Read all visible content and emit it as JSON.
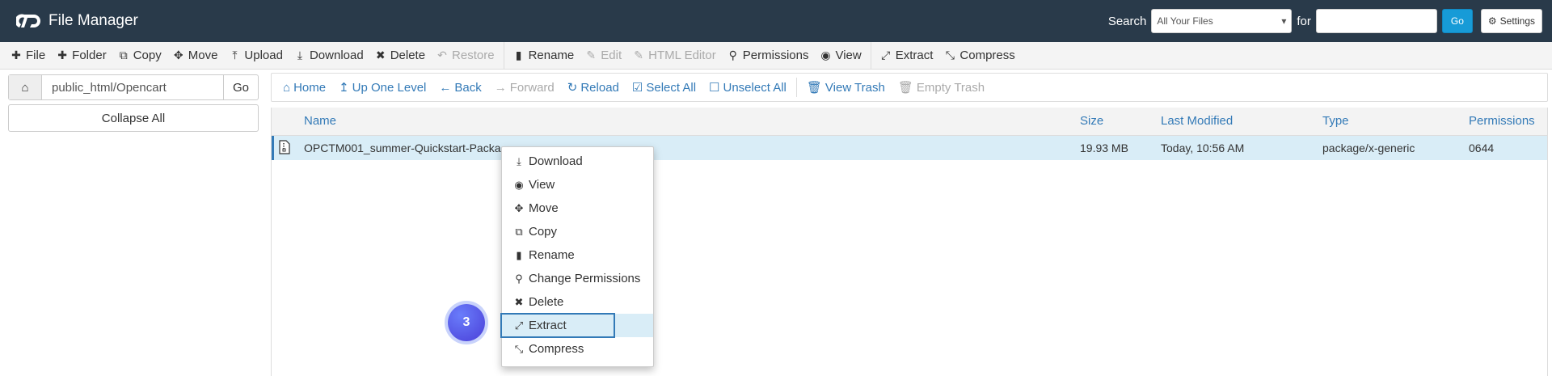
{
  "header": {
    "title": "File Manager",
    "search_label": "Search",
    "search_select_value": "All Your Files",
    "for_label": "for",
    "search_value": "",
    "go_label": "Go",
    "settings_label": "Settings"
  },
  "toolbar": {
    "items": [
      {
        "label": "File",
        "icon": "plus-icon"
      },
      {
        "label": "Folder",
        "icon": "plus-icon"
      },
      {
        "label": "Copy",
        "icon": "copy-icon"
      },
      {
        "label": "Move",
        "icon": "move-icon"
      },
      {
        "label": "Upload",
        "icon": "upload-icon"
      },
      {
        "label": "Download",
        "icon": "download-icon"
      },
      {
        "label": "Delete",
        "icon": "close-icon"
      },
      {
        "label": "Restore",
        "icon": "restore-icon"
      },
      {
        "label": "Rename",
        "icon": "file-icon"
      },
      {
        "label": "Edit",
        "icon": "pencil-icon"
      },
      {
        "label": "HTML Editor",
        "icon": "html-editor-icon"
      },
      {
        "label": "Permissions",
        "icon": "key-icon"
      },
      {
        "label": "View",
        "icon": "eye-icon"
      },
      {
        "label": "Extract",
        "icon": "expand-icon"
      },
      {
        "label": "Compress",
        "icon": "compress-icon"
      }
    ]
  },
  "left_pane": {
    "path_value": "public_html/Opencart",
    "go_label": "Go",
    "collapse_label": "Collapse All"
  },
  "navbar": {
    "items": [
      {
        "label": "Home",
        "icon": "home-icon"
      },
      {
        "label": "Up One Level",
        "icon": "level-up-icon"
      },
      {
        "label": "Back",
        "icon": "arrow-left-icon"
      },
      {
        "label": "Forward",
        "icon": "arrow-right-icon"
      },
      {
        "label": "Reload",
        "icon": "refresh-icon"
      },
      {
        "label": "Select All",
        "icon": "checkbox-checked-icon"
      },
      {
        "label": "Unselect All",
        "icon": "checkbox-empty-icon"
      },
      {
        "label": "View Trash",
        "icon": "trash-icon"
      },
      {
        "label": "Empty Trash",
        "icon": "trash-icon"
      }
    ]
  },
  "file_table": {
    "columns": [
      "Name",
      "Size",
      "Last Modified",
      "Type",
      "Permissions"
    ],
    "rows": [
      {
        "name": "OPCTM001_summer-Quickstart-Packa",
        "size": "19.93 MB",
        "modified": "Today, 10:56 AM",
        "type": "package/x-generic",
        "permissions": "0644"
      }
    ]
  },
  "context_menu": {
    "items": [
      {
        "label": "Download",
        "icon": "download-icon"
      },
      {
        "label": "View",
        "icon": "eye-icon"
      },
      {
        "label": "Move",
        "icon": "move-icon"
      },
      {
        "label": "Copy",
        "icon": "copy-icon"
      },
      {
        "label": "Rename",
        "icon": "file-icon"
      },
      {
        "label": "Change Permissions",
        "icon": "key-icon"
      },
      {
        "label": "Delete",
        "icon": "close-icon"
      },
      {
        "label": "Extract",
        "icon": "expand-icon"
      },
      {
        "label": "Compress",
        "icon": "compress-icon"
      }
    ]
  },
  "step_badge": "3",
  "colors": {
    "header_bg": "#293a4a",
    "link": "#337ab7",
    "selected_row": "#d9edf7",
    "go_button": "#179bd7"
  }
}
